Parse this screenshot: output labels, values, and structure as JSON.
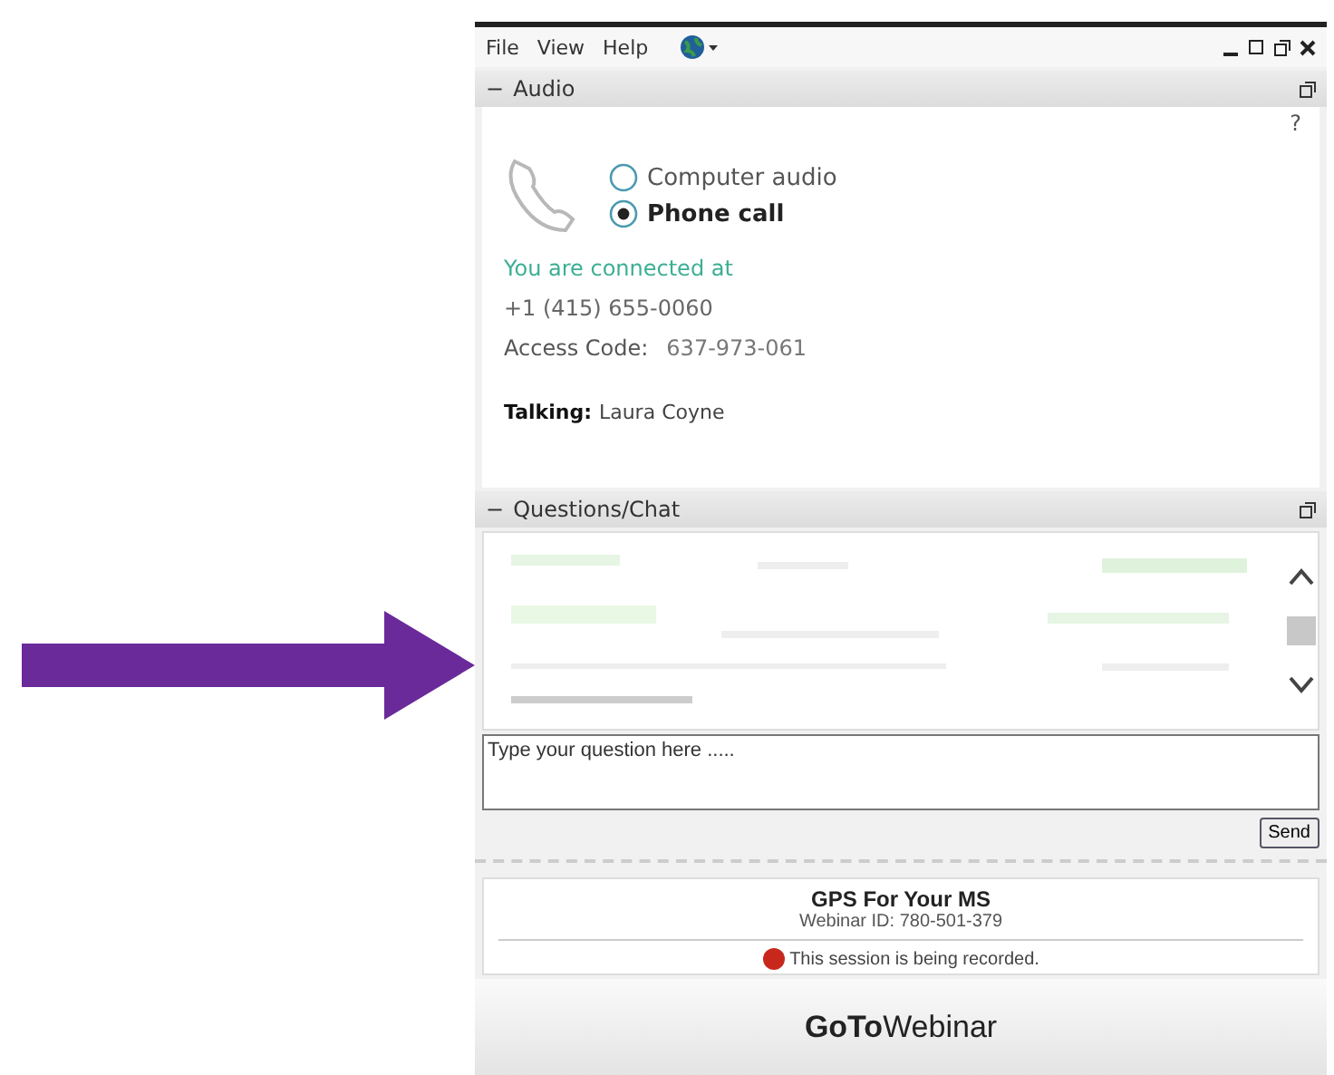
{
  "menu": {
    "items": [
      "File",
      "View",
      "Help"
    ]
  },
  "audio": {
    "collapse": "−",
    "title": "Audio",
    "help": "?",
    "options": [
      {
        "label": "Computer audio",
        "selected": false
      },
      {
        "label": "Phone call",
        "selected": true
      }
    ],
    "connected": "You are connected at",
    "phone": "+1 (415) 655-0060",
    "access_label": "Access Code:",
    "access_code": "637-973-061",
    "talking_label": "Talking:",
    "talking_name": "Laura Coyne"
  },
  "chat": {
    "collapse": "−",
    "title": "Questions/Chat",
    "placeholder": "Type your question here .....",
    "send": "Send"
  },
  "info": {
    "title": "GPS For Your MS",
    "webinar_id": "Webinar ID: 780-501-379",
    "recording": "This session is being recorded."
  },
  "brand": "**GoTo**Webinar"
}
